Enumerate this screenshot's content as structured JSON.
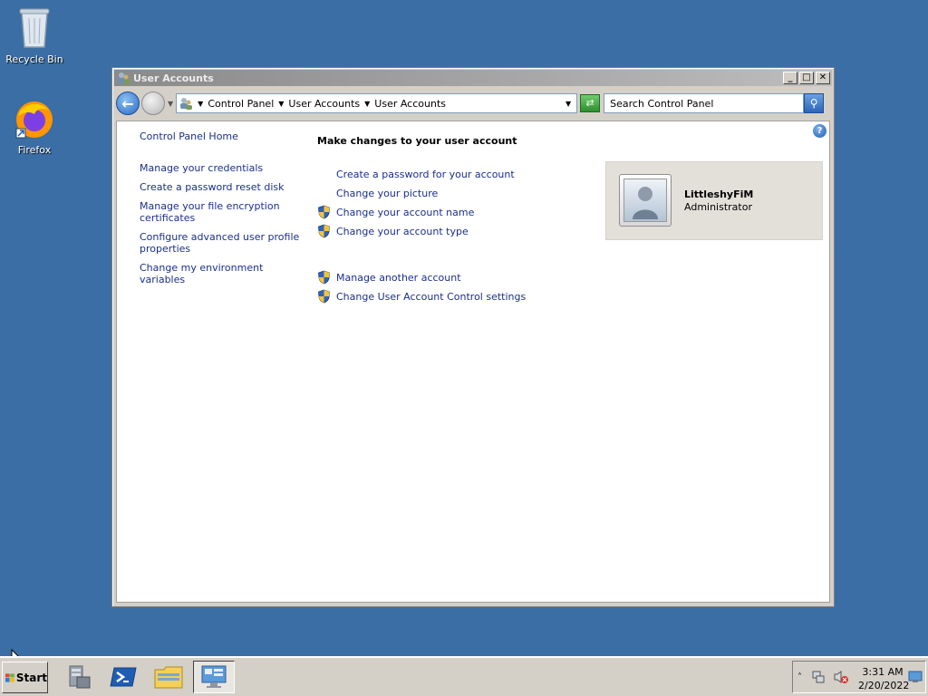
{
  "desktop": {
    "icons": [
      {
        "label": "Recycle Bin"
      },
      {
        "label": "Firefox"
      }
    ]
  },
  "window": {
    "title": "User Accounts",
    "controls": {
      "minimize": "_",
      "maximize": "□",
      "close": "✕"
    },
    "address_bar": {
      "crumbs": [
        "Control Panel",
        "User Accounts",
        "User Accounts"
      ]
    },
    "search": {
      "placeholder": "Search Control Panel",
      "value": "Search Control Panel"
    },
    "help": "?"
  },
  "left_nav": {
    "home": "Control Panel Home",
    "tasks": [
      "Manage your credentials",
      "Create a password reset disk",
      "Manage your file encryption certificates",
      "Configure advanced user profile properties",
      "Change my environment variables"
    ]
  },
  "main": {
    "heading": "Make changes to your user account",
    "tasks": [
      {
        "label": "Create a password for your account",
        "shield": false
      },
      {
        "label": "Change your picture",
        "shield": false
      },
      {
        "label": "Change your account name",
        "shield": true
      },
      {
        "label": "Change your account type",
        "shield": true
      }
    ],
    "other_tasks": [
      {
        "label": "Manage another account",
        "shield": true
      },
      {
        "label": "Change User Account Control settings",
        "shield": true
      }
    ]
  },
  "account": {
    "name": "LittleshyFiM",
    "role": "Administrator"
  },
  "taskbar": {
    "start_label": "Start",
    "clock": {
      "time": "3:31 AM",
      "date": "2/20/2022"
    }
  },
  "colors": {
    "desktop": "#3a6ea5",
    "link": "#1a2f8b"
  }
}
